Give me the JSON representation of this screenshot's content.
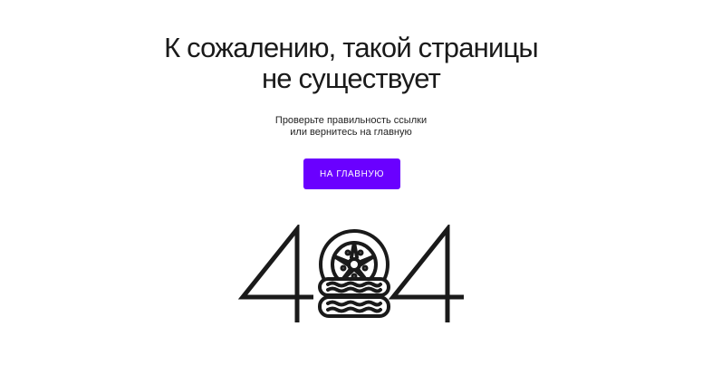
{
  "error": {
    "title_line1": "К сожалению, такой страницы",
    "title_line2": "не существует",
    "hint_line1": "Проверьте правильность ссылки",
    "hint_line2": "или вернитесь на главную",
    "home_button_label": "НА ГЛАВНУЮ",
    "code_left_digit": "4",
    "code_right_digit": "4",
    "middle_icon": "tires-stack-icon"
  },
  "colors": {
    "accent": "#6a00ff",
    "text": "#1a1a1a",
    "background": "#ffffff"
  }
}
